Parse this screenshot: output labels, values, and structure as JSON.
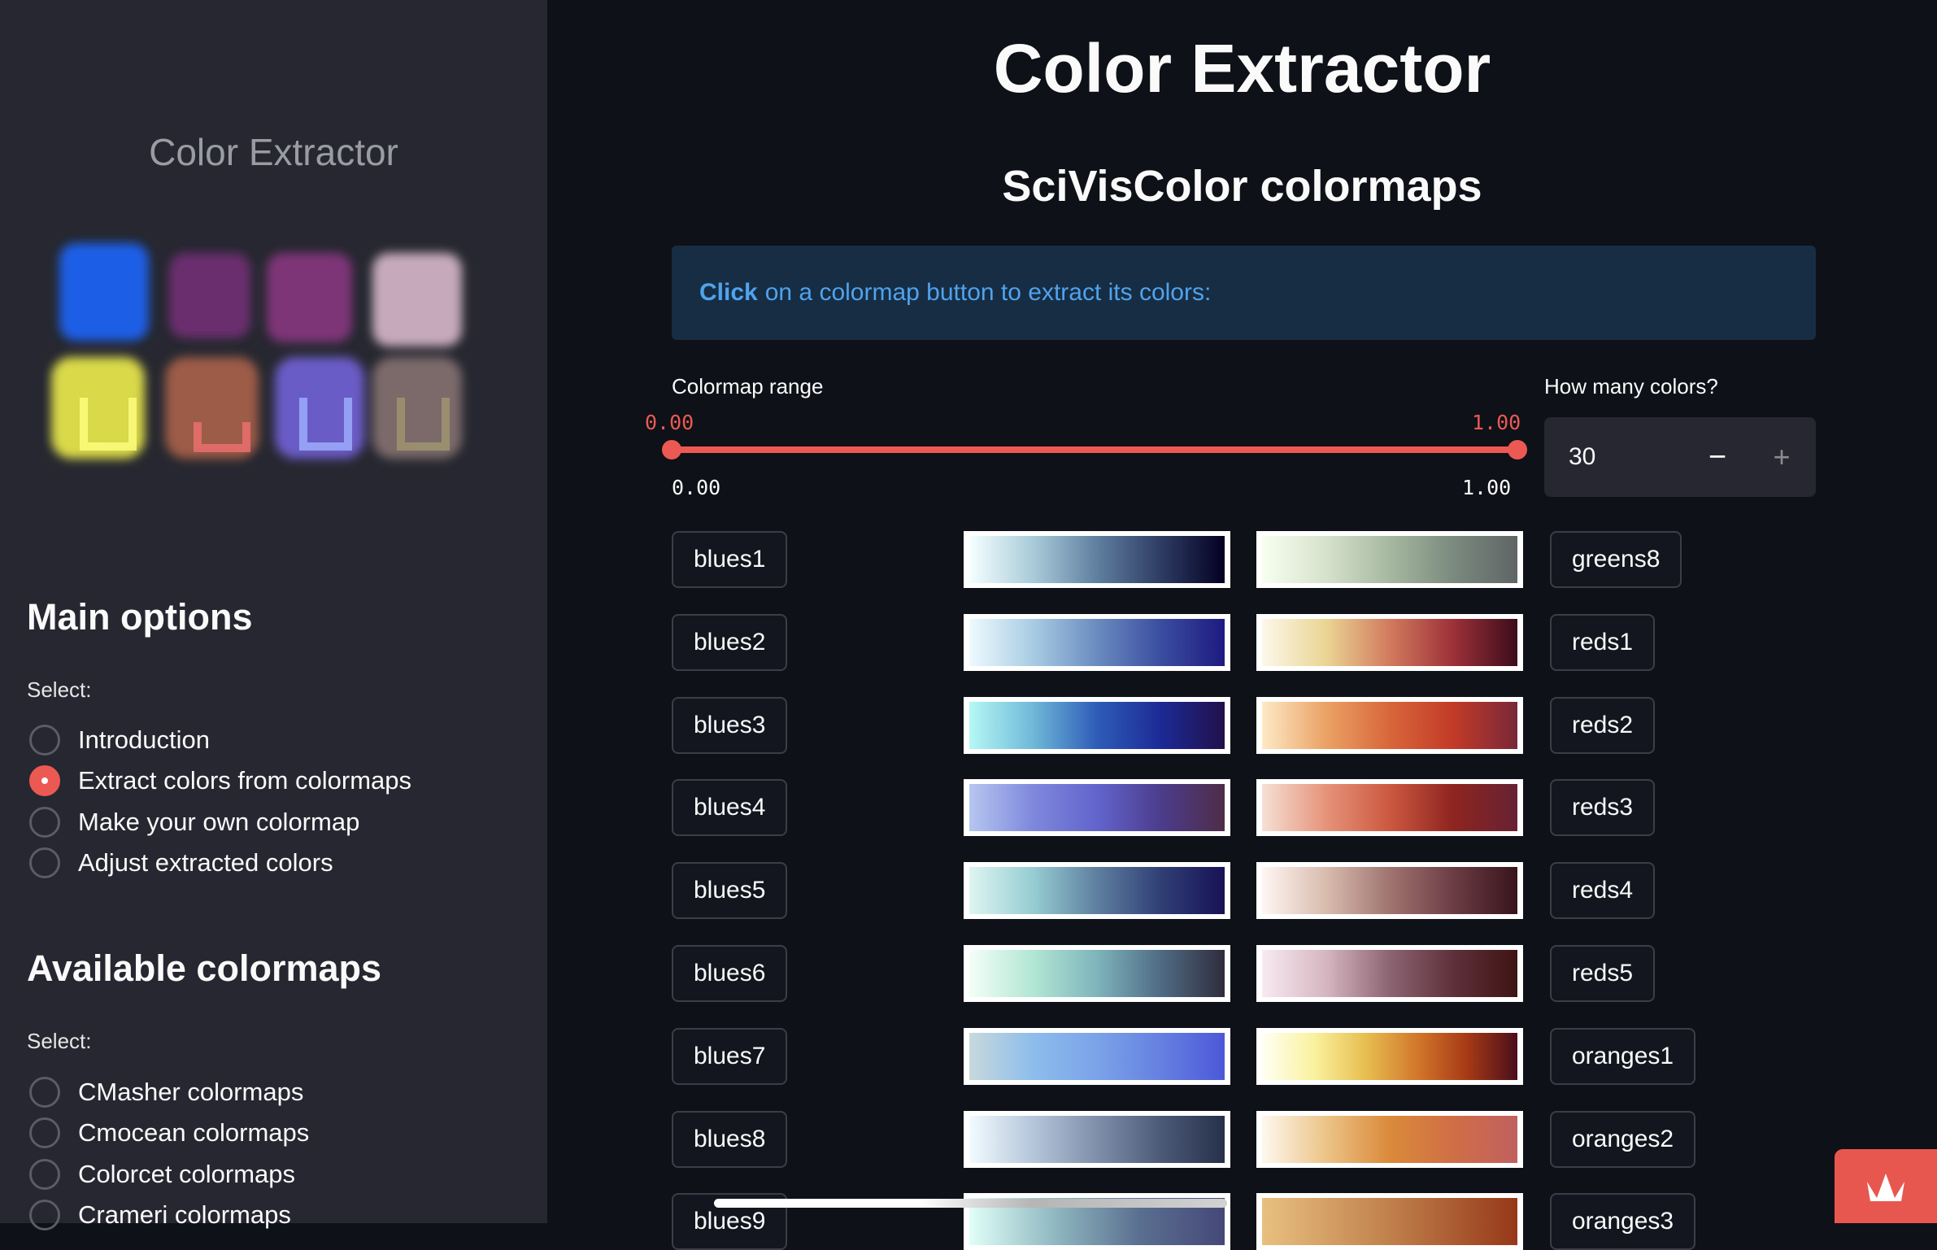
{
  "sidebar": {
    "title": "Color Extractor",
    "main_options": {
      "heading": "Main options",
      "select_label": "Select:",
      "options": [
        "Introduction",
        "Extract colors from colormaps",
        "Make your own colormap",
        "Adjust extracted colors"
      ],
      "selected": 1
    },
    "available": {
      "heading": "Available colormaps",
      "select_label": "Select:",
      "options": [
        "CMasher colormaps",
        "Cmocean colormaps",
        "Colorcet colormaps",
        "Crameri colormaps"
      ]
    }
  },
  "main": {
    "title": "Color Extractor",
    "subtitle": "SciVisColor colormaps",
    "info_bold": "Click",
    "info_rest": "on a colormap button to extract its colors:",
    "range": {
      "label": "Colormap range",
      "low": "0.00",
      "high": "1.00",
      "min": "0.00",
      "max": "1.00"
    },
    "count": {
      "label": "How many colors?",
      "value": "30",
      "minus": "−",
      "plus": "+"
    }
  },
  "accent": "#ec5953",
  "left_colormaps": [
    {
      "name": "blues1",
      "colors": [
        "#f5ffff",
        "#a9cbd9",
        "#5f7fa0",
        "#2e3c63",
        "#030021"
      ]
    },
    {
      "name": "blues2",
      "colors": [
        "#eefaff",
        "#a8cce3",
        "#6a8bc0",
        "#3a4da0",
        "#1e1a80"
      ]
    },
    {
      "name": "blues3",
      "colors": [
        "#b5f8f5",
        "#6fb8d8",
        "#2e5cb8",
        "#1c2a96",
        "#22104a"
      ]
    },
    {
      "name": "blues4",
      "colors": [
        "#b6c6f0",
        "#7e88dc",
        "#6264cc",
        "#4c3c8c",
        "#4e2c48"
      ]
    },
    {
      "name": "blues5",
      "colors": [
        "#def5f2",
        "#96cdd2",
        "#5e7fa0",
        "#303f75",
        "#171255"
      ]
    },
    {
      "name": "blues6",
      "colors": [
        "#f3fff8",
        "#b2e6d4",
        "#7eb4bc",
        "#4f6b84",
        "#2f2c3c"
      ]
    },
    {
      "name": "blues7",
      "colors": [
        "#c8d9dc",
        "#8dbdec",
        "#7aa3e8",
        "#6580e0",
        "#4c58d8"
      ]
    },
    {
      "name": "blues8",
      "colors": [
        "#f2fbff",
        "#b5c5da",
        "#7f8faa",
        "#4c5a78",
        "#26304a"
      ]
    },
    {
      "name": "blues9",
      "colors": [
        "#e0fff8",
        "#8fb8c0",
        "#5a6f90",
        "#454878"
      ]
    }
  ],
  "right_colormaps": [
    {
      "name": "greens8",
      "colors": [
        "#f8fff0",
        "#d6e2cc",
        "#a6b8a0",
        "#7a8a7e",
        "#5f6566"
      ]
    },
    {
      "name": "reds1",
      "colors": [
        "#fcf8ea",
        "#ead594",
        "#d27a5e",
        "#9c3038",
        "#3c0c1c"
      ]
    },
    {
      "name": "reds2",
      "colors": [
        "#fde9c5",
        "#eba265",
        "#d8663a",
        "#c23a28",
        "#782838"
      ]
    },
    {
      "name": "reds3",
      "colors": [
        "#f5e0d4",
        "#e6937a",
        "#cc5840",
        "#8e2420",
        "#662234"
      ]
    },
    {
      "name": "reds4",
      "colors": [
        "#fff6f2",
        "#d8bcae",
        "#a07470",
        "#6c3c44",
        "#38141c"
      ]
    },
    {
      "name": "reds5",
      "colors": [
        "#f8eaf2",
        "#d6b6c0",
        "#8c6472",
        "#5e303a",
        "#3e1412"
      ]
    },
    {
      "name": "oranges1",
      "colors": [
        "#fffff4",
        "#faf2a0",
        "#e8c052",
        "#d37a2c",
        "#a83a16",
        "#4a0e1a"
      ]
    },
    {
      "name": "oranges2",
      "colors": [
        "#fdf8ee",
        "#ecc488",
        "#da8a3a",
        "#d06e46",
        "#c06060"
      ]
    },
    {
      "name": "oranges3",
      "colors": [
        "#e8c080",
        "#c0804c",
        "#963818"
      ]
    }
  ]
}
